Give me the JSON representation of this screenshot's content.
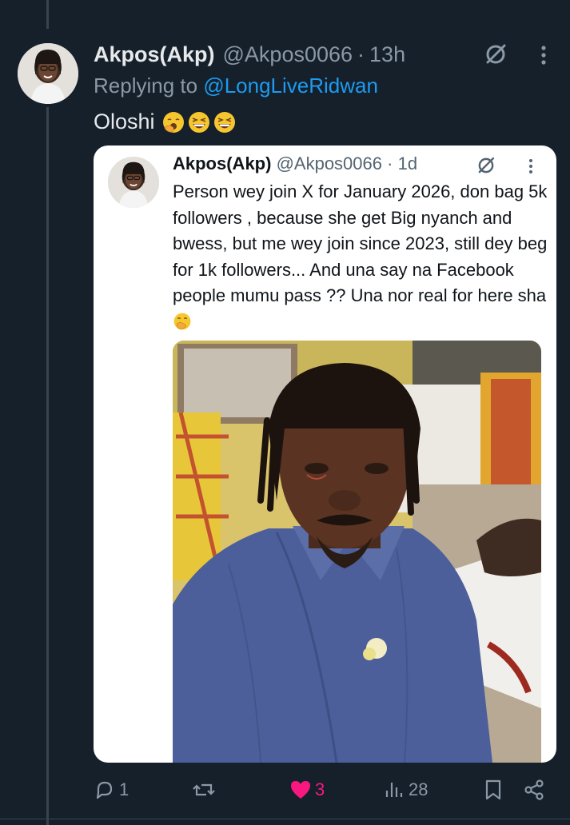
{
  "tweet": {
    "author_name": "Akpos(Akp)",
    "author_handle": "@Akpos0066",
    "separator": "·",
    "time": "13h",
    "replying_prefix": "Replying to",
    "replying_to": "@LongLiveRidwan",
    "text": "Oloshi",
    "emojis": [
      "yawning-face",
      "grinning-squinting-face",
      "grinning-squinting-face"
    ]
  },
  "quote": {
    "author_name": "Akpos(Akp)",
    "author_handle": "@Akpos0066",
    "separator": "·",
    "time": "1d",
    "text": "Person wey join X for January 2026, don bag 5k followers , because she get Big nyanch and bwess, but me wey join since 2023, still dey beg for 1k followers... And una say na Facebook people mumu pass ?? Una nor real for here sha",
    "trailing_emoji": "face-with-hand-over-mouth"
  },
  "actions": {
    "replies": "1",
    "reposts": "",
    "likes": "3",
    "views": "28"
  },
  "colors": {
    "background": "#15202b",
    "accent": "#1d9bf0",
    "like": "#f91880",
    "muted": "#8b98a5"
  }
}
